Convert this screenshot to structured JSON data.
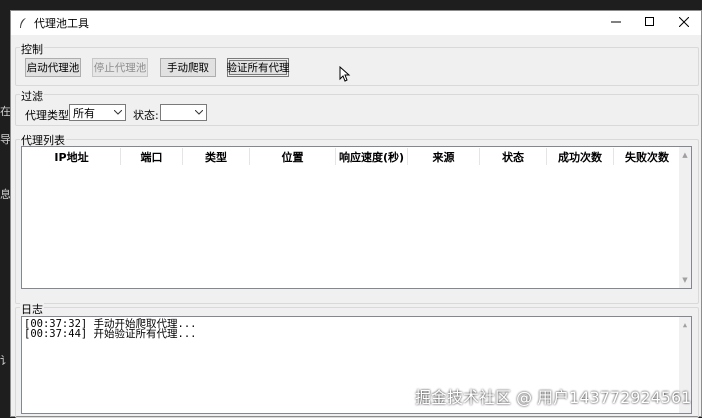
{
  "window": {
    "title": "代理池工具"
  },
  "controls_group": {
    "label": "控制",
    "buttons": {
      "start": "启动代理池",
      "stop": "停止代理池",
      "crawl": "手动爬取",
      "verify": "验证所有代理"
    }
  },
  "filter_group": {
    "label": "过滤",
    "type_label": "代理类型:",
    "type_value": "所有",
    "status_label": "状态:",
    "status_value": ""
  },
  "proxy_list": {
    "label": "代理列表",
    "columns": [
      "IP地址",
      "端口",
      "类型",
      "位置",
      "响应速度(秒)",
      "来源",
      "状态",
      "成功次数",
      "失败次数"
    ]
  },
  "log_group": {
    "label": "日志",
    "lines": [
      "[00:37:32] 手动开始爬取代理...",
      "[00:37:44] 开始验证所有代理..."
    ]
  },
  "side_text": [
    "在",
    "导",
    "息",
    "讠"
  ],
  "watermark": "掘金技术社区 @ 用户143772924561"
}
